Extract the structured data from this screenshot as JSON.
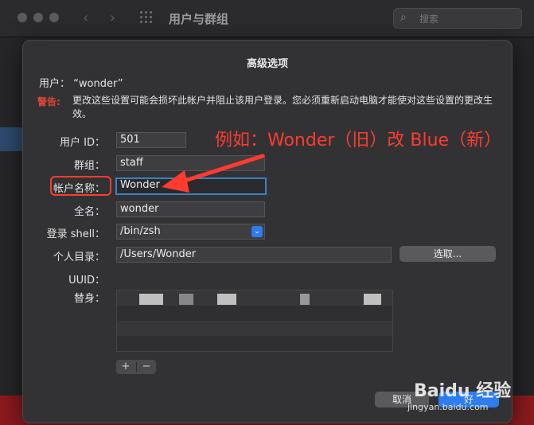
{
  "window": {
    "title": "用户与群组",
    "search_placeholder": "搜索"
  },
  "sheet": {
    "title": "高级选项",
    "user_line": "用户：  “wonder”",
    "warning_label": "警告:",
    "warning_text": "更改这些设置可能会损坏此帐户并阻止该用户登录。您必须重新启动电脑才能使对这些设置的更改生效。",
    "fields": {
      "user_id": {
        "label": "用户 ID：",
        "value": "501"
      },
      "group": {
        "label": "群组：",
        "value": "staff"
      },
      "account_name": {
        "label": "帐户名称：",
        "value": "Wonder"
      },
      "full_name": {
        "label": "全名：",
        "value": "wonder"
      },
      "login_shell": {
        "label": "登录 shell：",
        "value": "/bin/zsh"
      },
      "home_dir": {
        "label": "个人目录：",
        "value": "/Users/Wonder"
      },
      "uuid": {
        "label": "UUID：",
        "value": ""
      },
      "aliases": {
        "label": "替身："
      }
    },
    "choose_button": "选取...",
    "plus_button": "+",
    "minus_button": "−",
    "cancel_button": "取消",
    "ok_button": "好"
  },
  "annotation": {
    "text": "例如：Wonder（旧）改 Blue（新）",
    "color": "#ff3b2f"
  },
  "watermark": {
    "brand": "Baidu 经验",
    "url": "jingyan.baidu.com"
  },
  "colors": {
    "accent": "#2f7bf0",
    "warning": "#e0453a"
  }
}
